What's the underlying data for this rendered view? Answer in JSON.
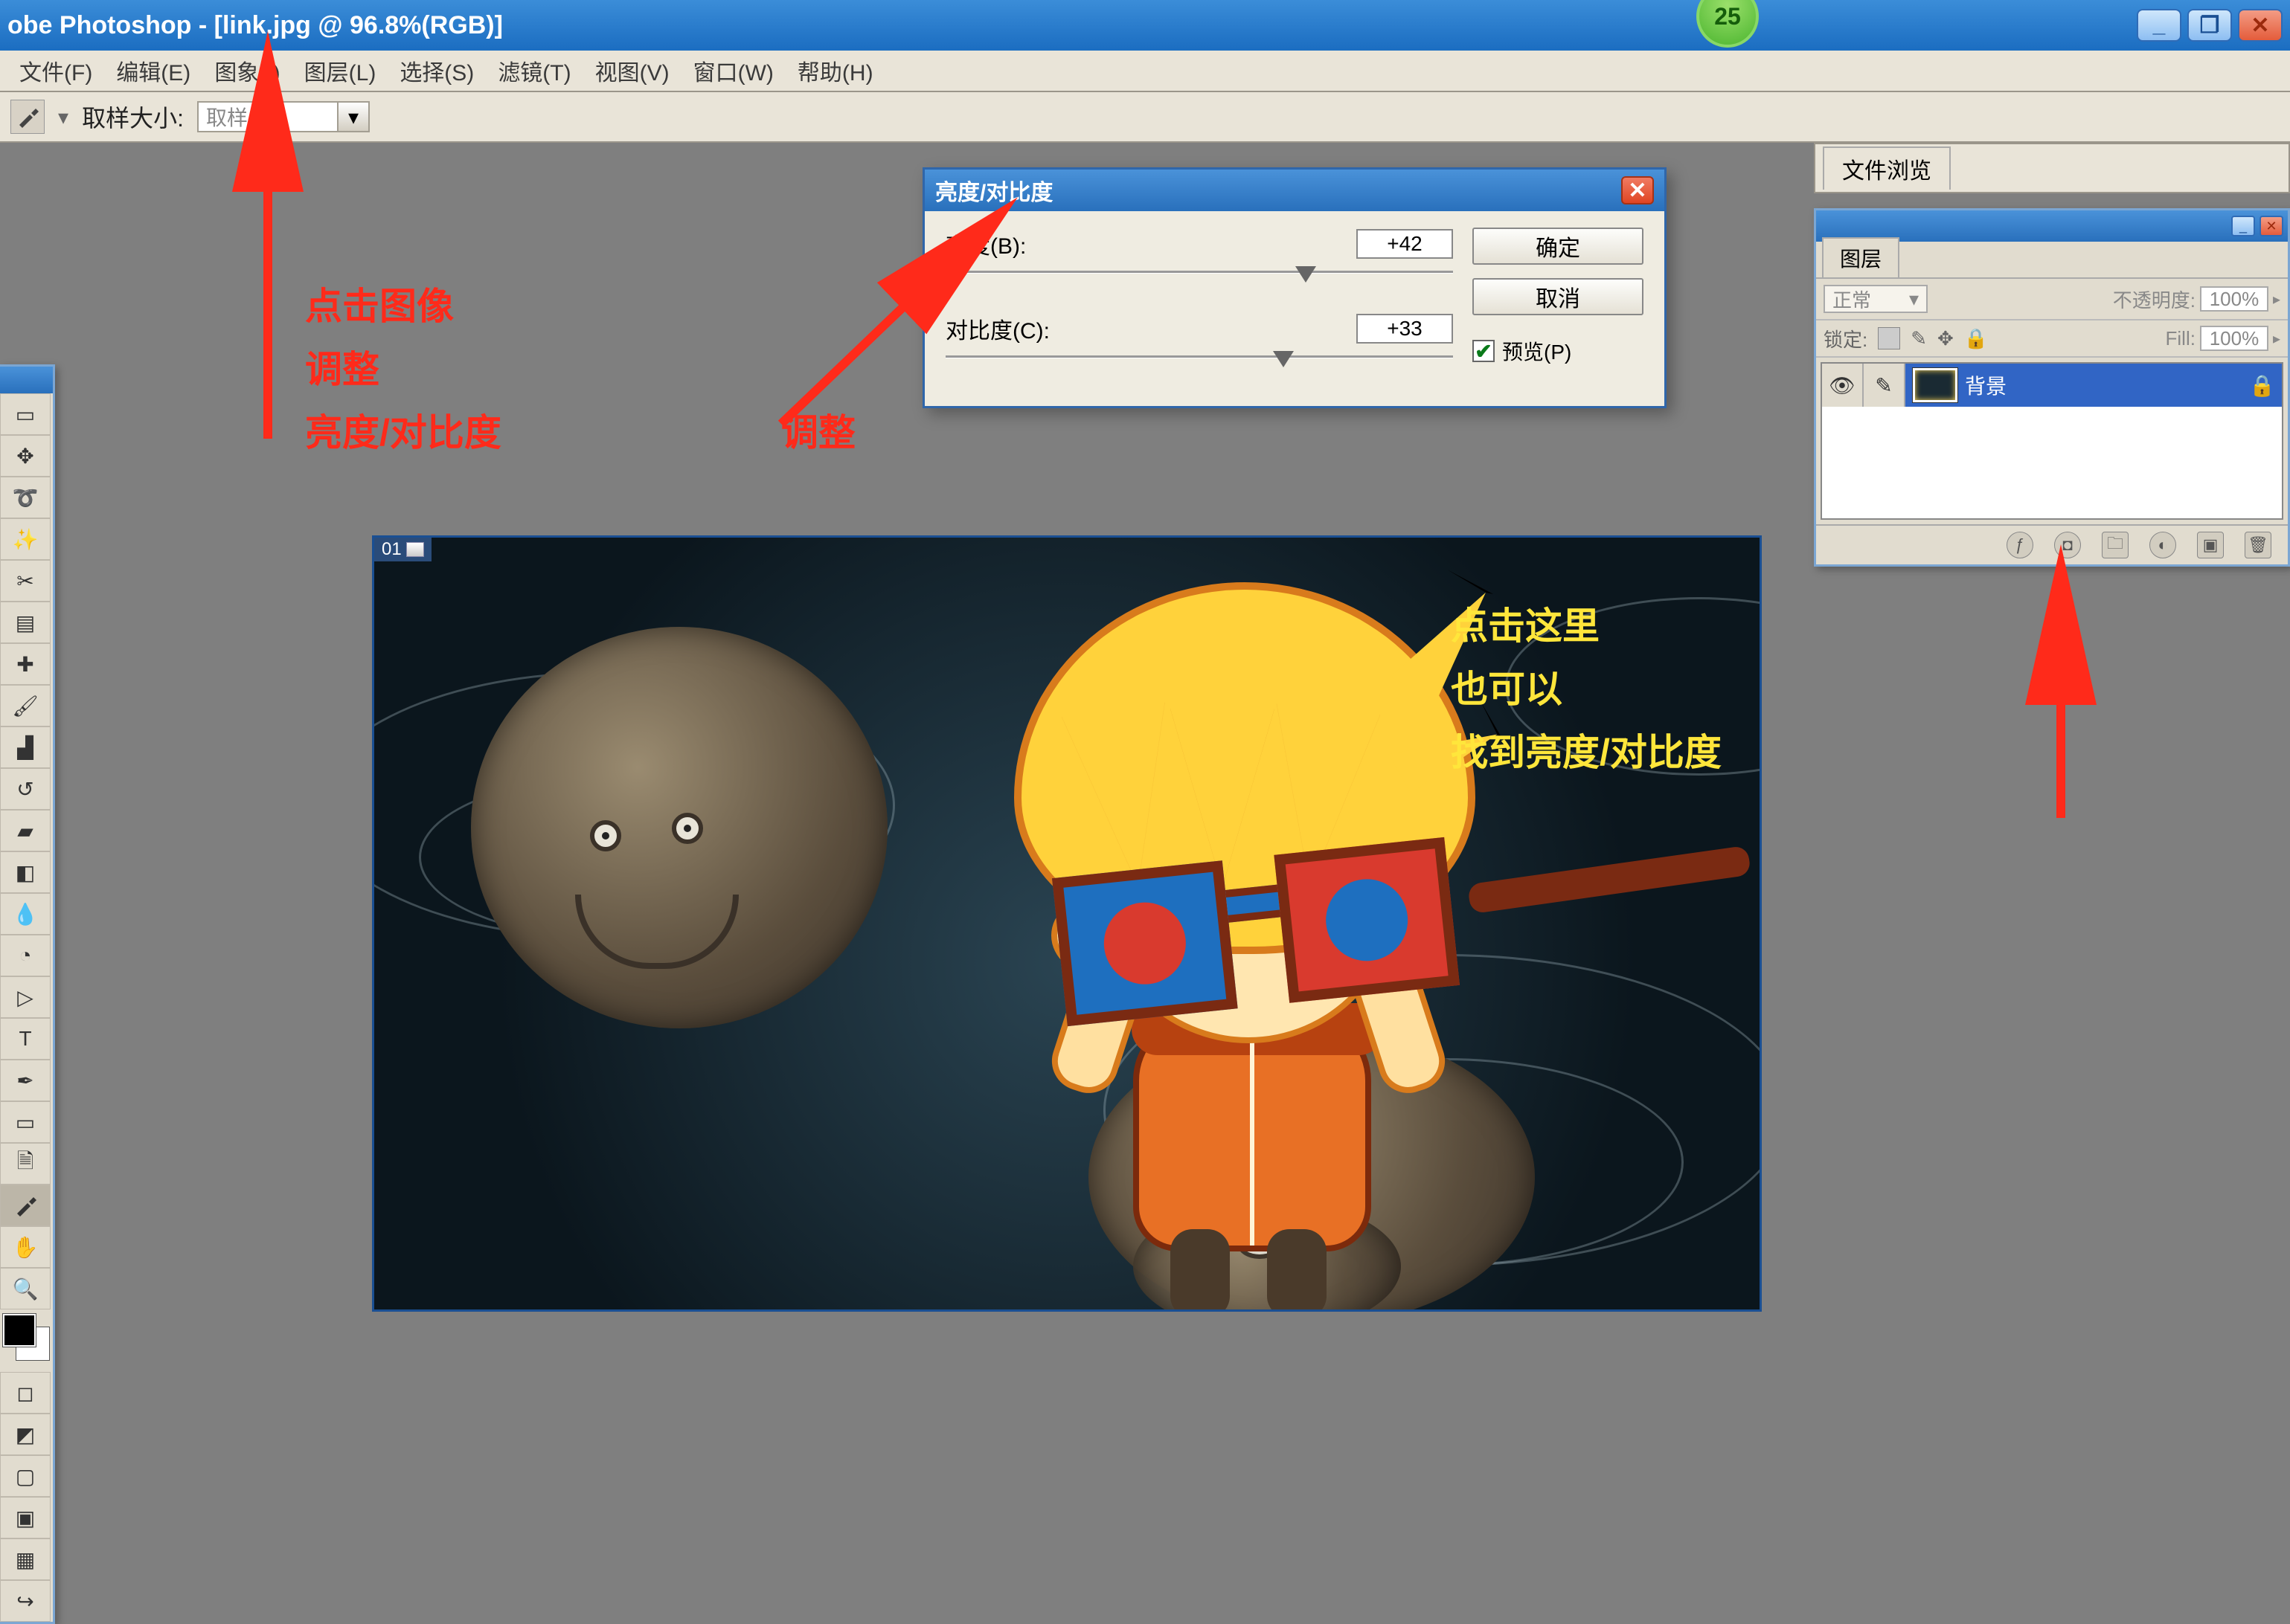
{
  "titlebar": {
    "text": "obe Photoshop - [link.jpg @ 96.8%(RGB)]"
  },
  "step_badge": "25",
  "menu": {
    "items": [
      "文件(F)",
      "编辑(E)",
      "图象(I)",
      "图层(L)",
      "选择(S)",
      "滤镜(T)",
      "视图(V)",
      "窗口(W)",
      "帮助(H)"
    ]
  },
  "options_bar": {
    "sample_label": "取样大小:",
    "sample_value": "取样点"
  },
  "file_browser": {
    "tab": "文件浏览"
  },
  "layers_panel": {
    "tab": "图层",
    "blend_mode": "正常",
    "opacity_label": "不透明度:",
    "opacity_value": "100%",
    "lock_label": "锁定:",
    "fill_label": "Fill:",
    "fill_value": "100%",
    "layer_name": "背景"
  },
  "dialog": {
    "title": "亮度/对比度",
    "brightness_label": "亮度(B):",
    "brightness_value": "+42",
    "contrast_label": "对比度(C):",
    "contrast_value": "+33",
    "ok_label": "确定",
    "cancel_label": "取消",
    "preview_label": "预览(P)"
  },
  "canvas_header": "01",
  "annotations": {
    "left_red": "点击图像\n调整\n亮度/对比度",
    "mid_red": "调整",
    "right_yellow": "点击这里\n也可以\n找到亮度/对比度"
  }
}
